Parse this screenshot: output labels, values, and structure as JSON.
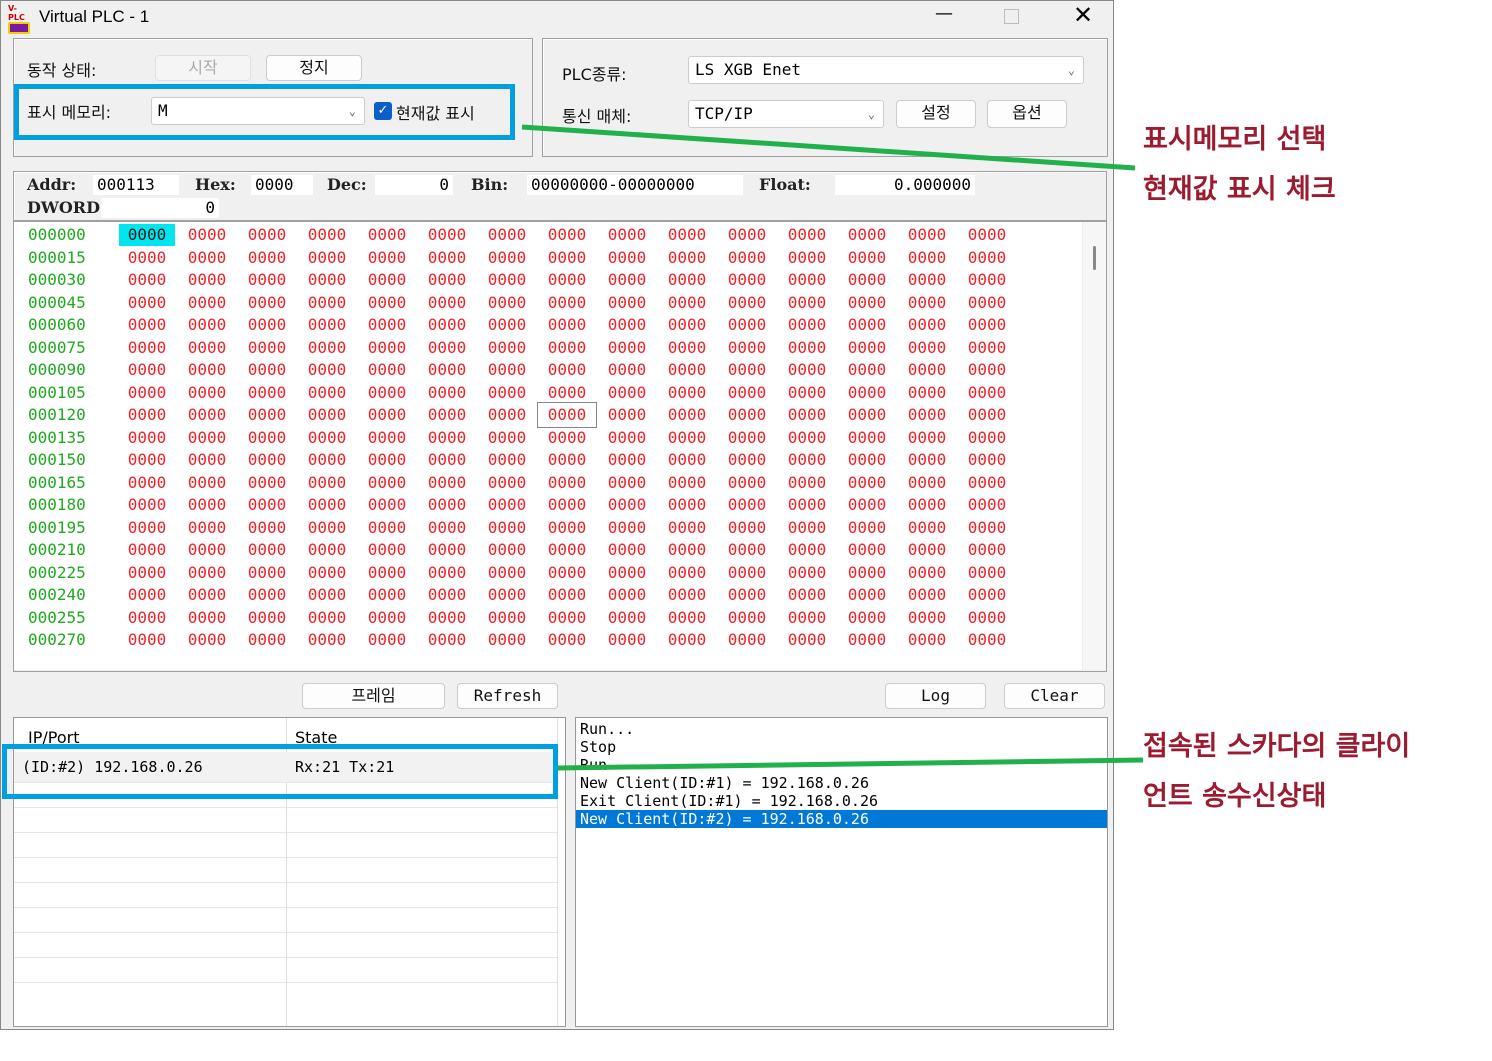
{
  "window": {
    "title": "Virtual PLC - 1",
    "icon_text": "V-PLC"
  },
  "controls": {
    "run_state_label": "동작 상태:",
    "start_button": "시작",
    "stop_button": "정지",
    "display_memory_label": "표시 메모리:",
    "display_memory_value": "M",
    "show_current_value_label": "현재값 표시",
    "show_current_value_checked": true,
    "plc_type_label": "PLC종류:",
    "plc_type_value": "LS XGB Enet",
    "comm_medium_label": "통신 매체:",
    "comm_medium_value": "TCP/IP",
    "settings_button": "설정",
    "options_button": "옵션"
  },
  "info": {
    "addr_label": "Addr:",
    "addr": "000113",
    "hex_label": "Hex:",
    "hex": "0000",
    "dec_label": "Dec:",
    "dec": "0",
    "bin_label": "Bin:",
    "bin": "00000000-00000000",
    "float_label": "Float:",
    "float": "0.000000",
    "dword_label": "DWORD:",
    "dword": "0"
  },
  "memory_grid": {
    "addresses": [
      "000000",
      "000015",
      "000030",
      "000045",
      "000060",
      "000075",
      "000090",
      "000105",
      "000120",
      "000135",
      "000150",
      "000165",
      "000180",
      "000195",
      "000210",
      "000225",
      "000240",
      "000255",
      "000270"
    ],
    "cell_value": "0000",
    "columns": 15,
    "address_color": "#1faa1f",
    "value_color": "#e8242a",
    "highlight_color": "#00e5ee"
  },
  "buttons": {
    "frame": "프레임",
    "refresh": "Refresh",
    "log": "Log",
    "clear": "Clear"
  },
  "clients": {
    "headers": [
      "IP/Port",
      "State"
    ],
    "rows": [
      {
        "ip": "(ID:#2) 192.168.0.26",
        "state": "Rx:21  Tx:21"
      }
    ]
  },
  "log": {
    "lines": [
      "Run...",
      "Stop",
      "Run",
      "New Client(ID:#1) = 192.168.0.26",
      "Exit Client(ID:#1) = 192.168.0.26",
      "New Client(ID:#2) = 192.168.0.26"
    ],
    "selected_index": 5
  },
  "annotations": {
    "a1_line1": "표시메모리 선택",
    "a1_line2": "현재값 표시 체크",
    "a2_line1": "접속된 스카다의 클라이",
    "a2_line2": "언트 송수신상태",
    "highlight_color": "#00a0e0",
    "line_color": "#22b04b",
    "text_color": "#9b1b30"
  }
}
